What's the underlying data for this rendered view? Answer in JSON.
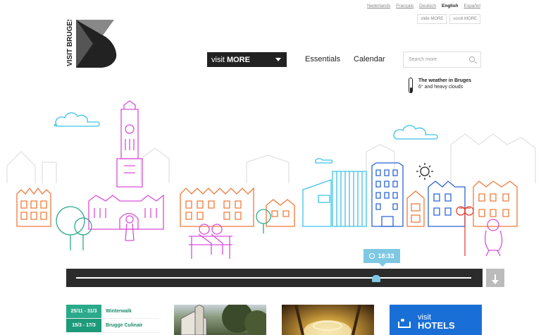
{
  "languages": [
    {
      "label": "Nederlands",
      "active": false
    },
    {
      "label": "Français",
      "active": false
    },
    {
      "label": "Deutsch",
      "active": false
    },
    {
      "label": "English",
      "active": true
    },
    {
      "label": "Español",
      "active": false
    }
  ],
  "toggles": {
    "slide": "slide MORE",
    "scroll": "scroll MORE"
  },
  "logo": {
    "text": "VISIT BRUGES"
  },
  "nav": {
    "visit_prefix": "visit",
    "visit_more": "MORE",
    "essentials": "Essentials",
    "calendar": "Calendar"
  },
  "search": {
    "placeholder": "Search more"
  },
  "weather": {
    "title": "The weather in Bruges",
    "detail": "6° and heavy clouds"
  },
  "timeline": {
    "time": "18:33",
    "progress": 0.76
  },
  "events": [
    {
      "date": "25/11 - 31/3",
      "name": "Winterwalk"
    },
    {
      "date": "15/3 - 17/3",
      "name": "Brugge Culinair"
    }
  ],
  "hotels_card": {
    "prefix": "visit",
    "label": "HOTELS"
  },
  "colors": {
    "orange": "#f07a3a",
    "magenta": "#d94fd9",
    "cyan": "#3cc3e6",
    "blue": "#2b63d6",
    "red": "#e0443a",
    "green": "#2aaa8a",
    "dark": "#2b2b2b"
  }
}
